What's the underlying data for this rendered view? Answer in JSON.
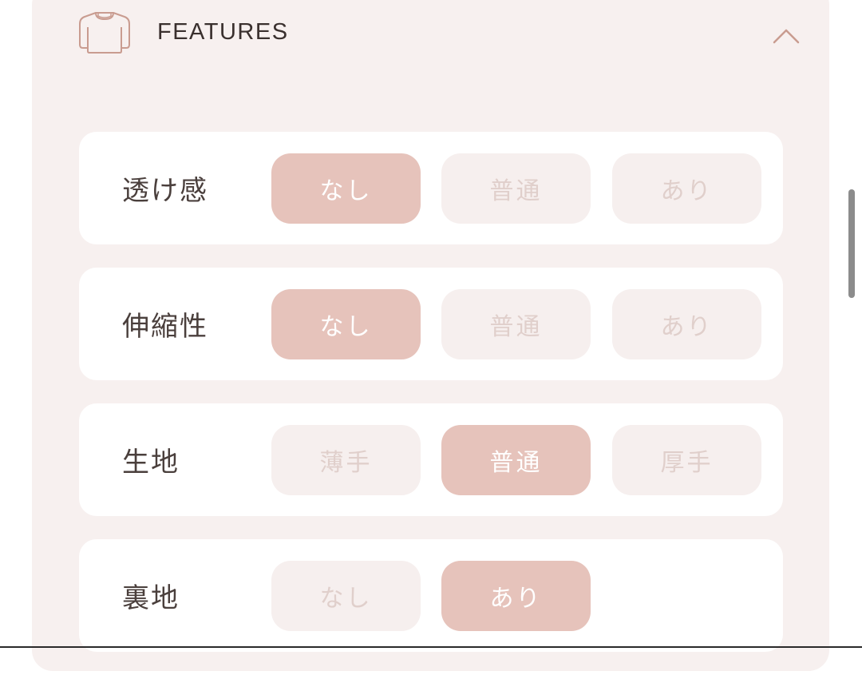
{
  "section": {
    "title": "FEATURES",
    "icon": "sweater-icon",
    "toggle_icon": "chevron-up-icon",
    "accent_color": "#e6c3bb"
  },
  "features": [
    {
      "label": "透け感",
      "options": [
        "なし",
        "普通",
        "あり"
      ],
      "selected": 0
    },
    {
      "label": "伸縮性",
      "options": [
        "なし",
        "普通",
        "あり"
      ],
      "selected": 0
    },
    {
      "label": "生地",
      "options": [
        "薄手",
        "普通",
        "厚手"
      ],
      "selected": 1
    },
    {
      "label": "裏地",
      "options": [
        "なし",
        "あり"
      ],
      "selected": 1
    }
  ]
}
